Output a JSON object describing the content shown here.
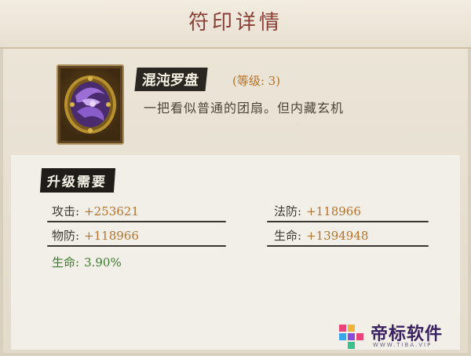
{
  "dialog": {
    "title": "符印详情"
  },
  "item": {
    "icon": "purple-fan-emblem-icon",
    "name": "混沌罗盘",
    "level": "(等级: 3)",
    "description": "一把看似普通的团扇。但内藏玄机"
  },
  "requirements": {
    "title": "升级需要",
    "stats": [
      {
        "label": "攻击:",
        "value": "+253621"
      },
      {
        "label": "法防:",
        "value": "+118966"
      },
      {
        "label": "物防:",
        "value": "+118966"
      },
      {
        "label": "生命:",
        "value": "+1394948"
      },
      {
        "label": "生命:",
        "value": "3.90%"
      }
    ]
  },
  "watermark": {
    "text": "帝标软件",
    "sub": "WWW.TIBA.VIP"
  },
  "colors": {
    "title": "#8a3f37",
    "stat_value": "#b8732b",
    "bonus": "#3b7b2e"
  }
}
